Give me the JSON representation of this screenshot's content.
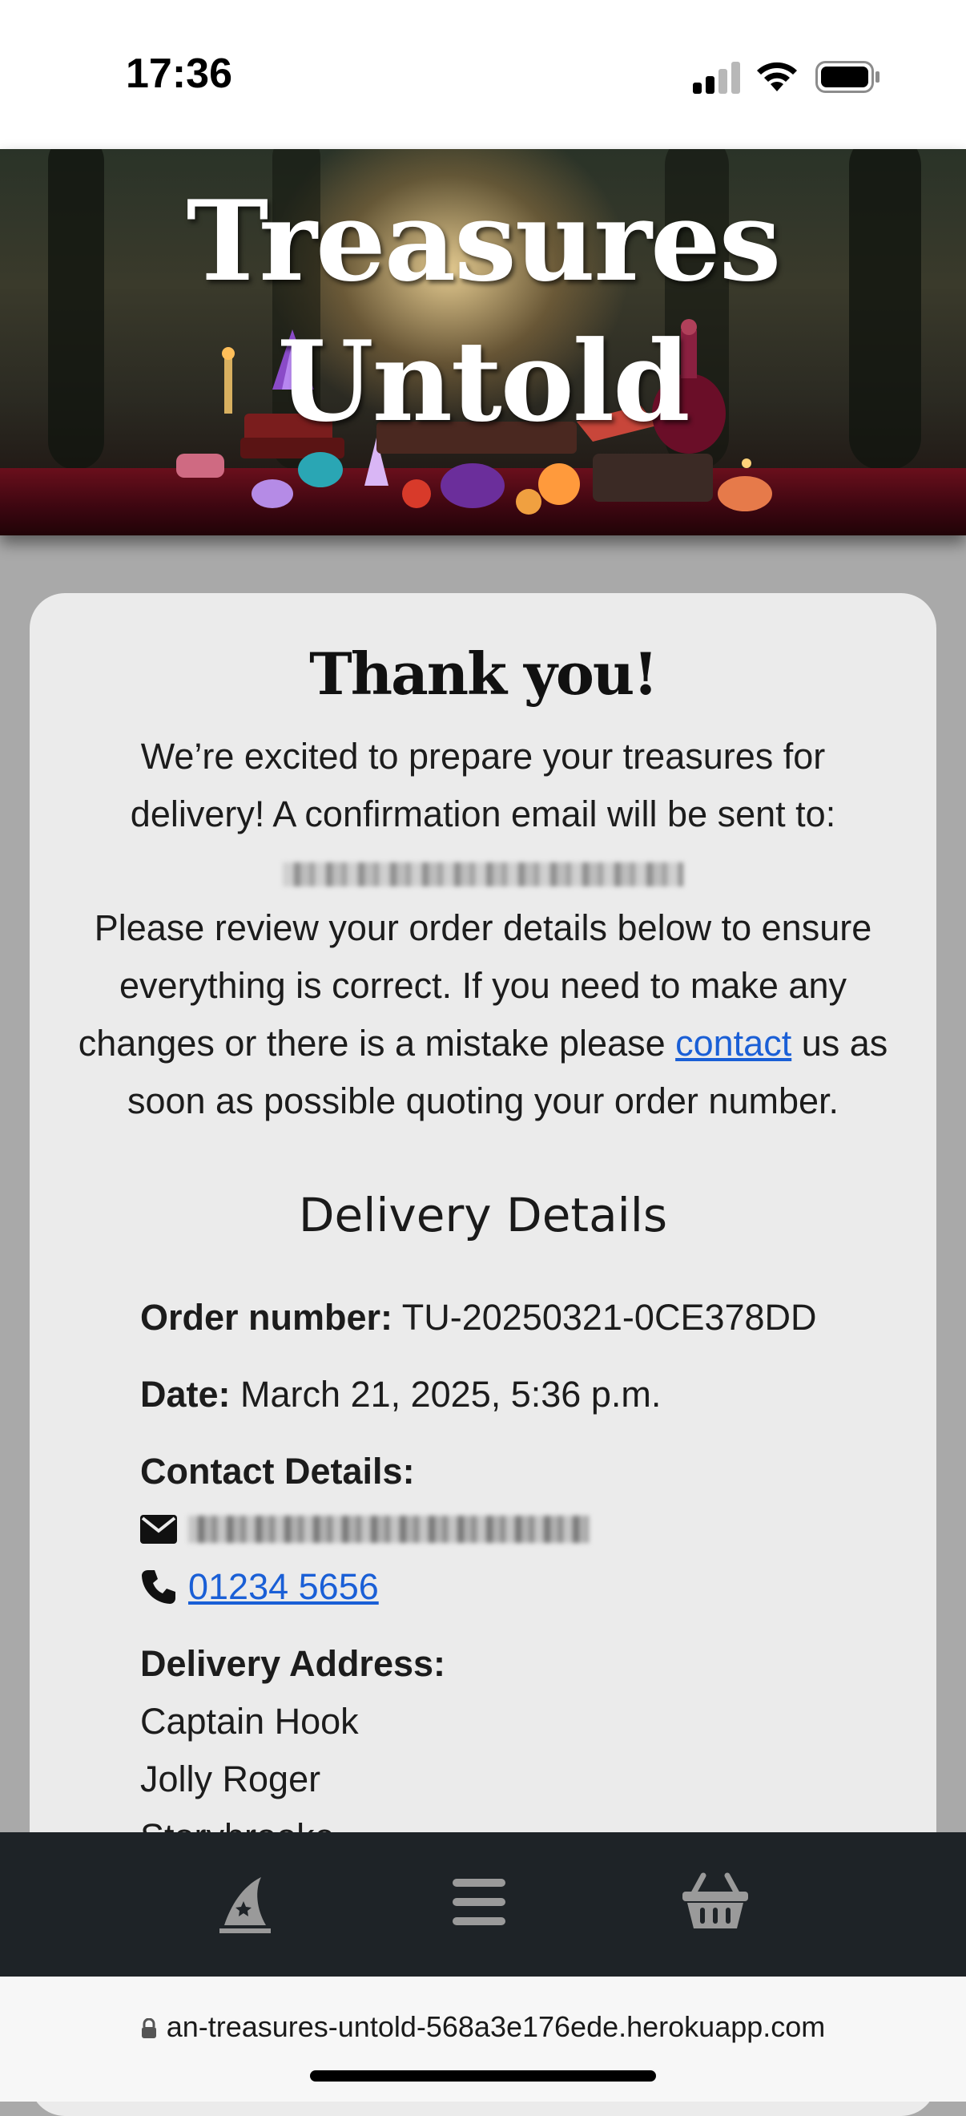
{
  "status_bar": {
    "time": "17:36"
  },
  "banner": {
    "title_line1": "Treasures",
    "title_line2": "Untold"
  },
  "confirmation": {
    "heading": "Thank you!",
    "intro_line": "We’re excited to prepare your treasures for delivery! A confirmation email will be sent to:",
    "review_text_before": "Please review your order details below to ensure everything is correct. If you need to make any changes or there is a mistake please ",
    "contact_link": "contact",
    "review_text_after": " us as soon as possible quoting your order number."
  },
  "delivery": {
    "heading": "Delivery Details",
    "order_number_label": "Order number:",
    "order_number": "TU-20250321-0CE378DD",
    "date_label": "Date:",
    "date": "March 21, 2025, 5:36 p.m.",
    "contact_label": "Contact Details:",
    "phone": "01234 5656",
    "address_label": "Delivery Address:",
    "address_lines": [
      "Captain Hook",
      "Jolly Roger",
      "Storybrooke"
    ]
  },
  "bottom_nav": {
    "items": [
      "wizard-hat-icon",
      "menu-icon",
      "basket-icon"
    ],
    "icon_color": "#9a9a9a"
  },
  "browser": {
    "url": "an-treasures-untold-568a3e176ede.herokuapp.com"
  },
  "colors": {
    "link": "#1a5fd6",
    "nav_bg": "#1e2327",
    "page_bg": "#a9a9a9",
    "card_bg": "#ebebeb"
  }
}
